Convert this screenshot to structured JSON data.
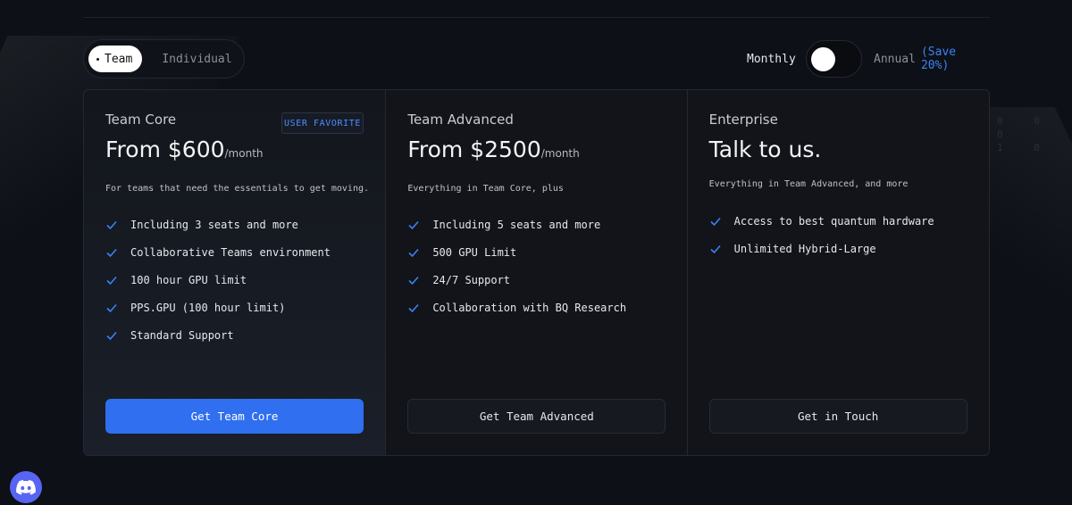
{
  "toggle": {
    "options": [
      "Team",
      "Individual"
    ],
    "selected": "Team"
  },
  "billing": {
    "monthly_label": "Monthly",
    "annual_label": "Annual",
    "save_label": "(Save 20%)",
    "selected": "Monthly"
  },
  "background": {
    "digits": [
      "0 0 0",
      "1 0"
    ]
  },
  "plans": [
    {
      "name": "Team Core",
      "badge": "USER FAVORITE",
      "price": "From $600",
      "period": "/month",
      "description": "For teams that need the essentials to get moving.",
      "features": [
        "Including 3 seats and more",
        "Collaborative Teams environment",
        "100 hour GPU limit",
        "PPS.GPU (100 hour limit)",
        "Standard Support"
      ],
      "cta": "Get Team Core"
    },
    {
      "name": "Team Advanced",
      "price": "From $2500",
      "period": "/month",
      "description": "Everything in Team Core, plus",
      "features": [
        "Including 5 seats and more",
        "500 GPU Limit",
        "24/7 Support",
        "Collaboration with BQ Research"
      ],
      "cta": "Get Team Advanced"
    },
    {
      "name": "Enterprise",
      "price": "Talk to us.",
      "period": "",
      "description": "Everything in Team Advanced, and more",
      "features": [
        "Access to best quantum hardware",
        "Unlimited Hybrid-Large"
      ],
      "cta": "Get in Touch"
    }
  ],
  "colors": {
    "accent": "#2f6ff0",
    "check": "#3b82f6",
    "background": "#0d1016",
    "discord": "#5865f2"
  },
  "icons": {
    "check": "check-icon",
    "discord": "discord-icon"
  }
}
